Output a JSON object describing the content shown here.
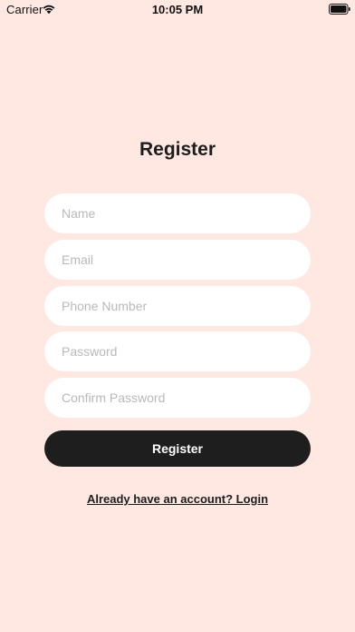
{
  "status_bar": {
    "carrier": "Carrier",
    "time": "10:05 PM",
    "icons": [
      "wifi-icon",
      "battery-icon"
    ]
  },
  "register": {
    "title": "Register",
    "fields": {
      "name_placeholder": "Name",
      "email_placeholder": "Email",
      "phone_placeholder": "Phone Number",
      "password_placeholder": "Password",
      "confirm_password_placeholder": "Confirm Password"
    },
    "submit_label": "Register",
    "login_link": "Already have an account? Login"
  },
  "colors": {
    "background": "#FFE7E2",
    "field_background": "#FFFFFF",
    "button_background": "#1E1E1E",
    "button_text": "#FFFFFF",
    "text": "#1D1D1D",
    "placeholder": "#B9B9B9"
  }
}
